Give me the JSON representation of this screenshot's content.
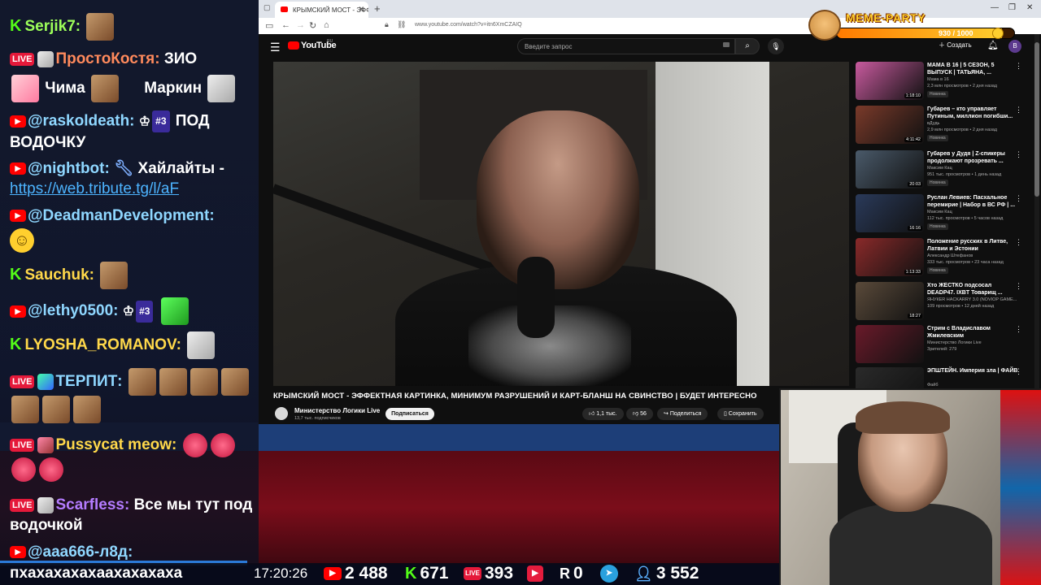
{
  "chat": {
    "messages": [
      {
        "platform": "kick",
        "nick": "Serjik7:",
        "text": ""
      },
      {
        "platform": "live",
        "nick": "ПростоКостя:",
        "text": "ЗИО"
      },
      {
        "platform": "none",
        "nick": "",
        "text": "Чима"
      },
      {
        "platform": "none",
        "nick": "",
        "text": "Маркин"
      },
      {
        "platform": "youtube",
        "nick": "@raskoldeath:",
        "rank": "#3",
        "text": "ПОД ВОДОЧКУ"
      },
      {
        "platform": "youtube",
        "nick": "@nightbot:",
        "text": "Хайлайты -"
      },
      {
        "platform": "none",
        "nick": "",
        "text": "https://web.tribute.tg/l/aF"
      },
      {
        "platform": "youtube",
        "nick": "@DeadmanDevelopment:",
        "text": ""
      },
      {
        "platform": "kick",
        "nick": "Sauchuk:",
        "text": ""
      },
      {
        "platform": "youtube",
        "nick": "@lethy0500:",
        "rank": "#3",
        "text": ""
      },
      {
        "platform": "kick",
        "nick": "LYOSHA_ROMANOV:",
        "text": ""
      },
      {
        "platform": "live",
        "nick": "ТЕРПИТ:",
        "text": ""
      },
      {
        "platform": "live",
        "nick": "Pussycat meow:",
        "text": ""
      },
      {
        "platform": "live",
        "nick": "Scarfless:",
        "text": "Все мы тут под водочкой"
      },
      {
        "platform": "youtube",
        "nick": "@aaa666-л8д:",
        "text": "пхахахахахаахахахаха"
      }
    ]
  },
  "browser": {
    "tab_title": "КРЫМСКИЙ МОСТ - ЭФФЕКТНАЯ",
    "url": "www.youtube.com/watch?v=itn6XmCZAIQ",
    "youtube": {
      "logo": "YouTube",
      "region": "RU",
      "search_placeholder": "Введите запрос",
      "create_label": "Создать",
      "avatar_letter": "В",
      "video_title": "КРЫМСКИЙ МОСТ - ЭФФЕКТНАЯ КАРТИНКА, МИНИМУМ РАЗРУШЕНИЙ И КАРТ-БЛАНШ НА СВИНСТВО | БУДЕТ ИНТЕРЕСНО",
      "channel_name": "Министерство Логики Live",
      "channel_subs": "13,7 тыс. подписчиков",
      "subscribe_label": "Подписаться",
      "likes": "1,1 тыс.",
      "dislikes": "56",
      "share_label": "Поделиться",
      "save_label": "Сохранить"
    },
    "recommendations": [
      {
        "title": "МАМА В 16 | 5 СЕЗОН, 5 ВЫПУСК | ТАТЬЯНА, ...",
        "channel": "Мама в 16",
        "meta": "2,3 млн просмотров • 2 дня назад",
        "badge": "Новинка",
        "duration": "1:18:10",
        "color": "#c85a9e"
      },
      {
        "title": "Губарев – кто управляет Путиным, миллион погибши...",
        "channel": "вДудь",
        "meta": "2,9 млн просмотров • 2 дня назад",
        "badge": "Новинка",
        "duration": "4:11:42",
        "color": "#7a3a2a"
      },
      {
        "title": "Губарев у Дудя | Z-спикеры продолжают прозревать ...",
        "channel": "Максим Кац",
        "meta": "951 тыс. просмотров • 1 день назад",
        "badge": "Новинка",
        "duration": "20:03",
        "color": "#4a5a6a"
      },
      {
        "title": "Руслан Левиев: Пасхальное перемирие | Набор в ВС РФ | ...",
        "channel": "Максим Кац",
        "meta": "112 тыс. просмотров • 5 часов назад",
        "badge": "Новинка",
        "duration": "16:16",
        "color": "#2a3a5a"
      },
      {
        "title": "Положение русских в Литве, Латвии и Эстонии",
        "channel": "Александр Штефанов",
        "meta": "333 тыс. просмотров • 23 часа назад",
        "badge": "Новинка",
        "duration": "1:13:33",
        "color": "#8a2a2a"
      },
      {
        "title": "Хто ЖЕСТКО подсосал DEADP47. IXBT Товарищ ...",
        "channel": "ЯНУКЕR HACKARRY 3.0 (NOVIOP GAME...",
        "meta": "109 просмотров • 12 дней назад",
        "badge": "",
        "duration": "18:27",
        "color": "#5a4a3a"
      },
      {
        "title": "Стрим с Владиславом Жмилевским",
        "channel": "Министерство Логики Live",
        "meta": "Зрителей: 279",
        "badge": "",
        "duration": "",
        "color": "#6a1a2a"
      },
      {
        "title": "ЭПШТЕЙН. Империя зла | ФАЙВ",
        "channel": "Файб",
        "meta": "",
        "badge": "",
        "duration": "",
        "color": "#2a2a2a"
      }
    ]
  },
  "meme_party": {
    "title": "MEME-PARTY",
    "count": "930 / 1000",
    "progress": 0.93
  },
  "stats": {
    "last_message": "пхахахахахаахахахаха",
    "time": "17:20:26",
    "youtube_viewers": "2 488",
    "kick_viewers": "671",
    "live_viewers": "393",
    "play_viewers": "",
    "rutube_viewers": "0",
    "total_viewers": "3 552"
  }
}
